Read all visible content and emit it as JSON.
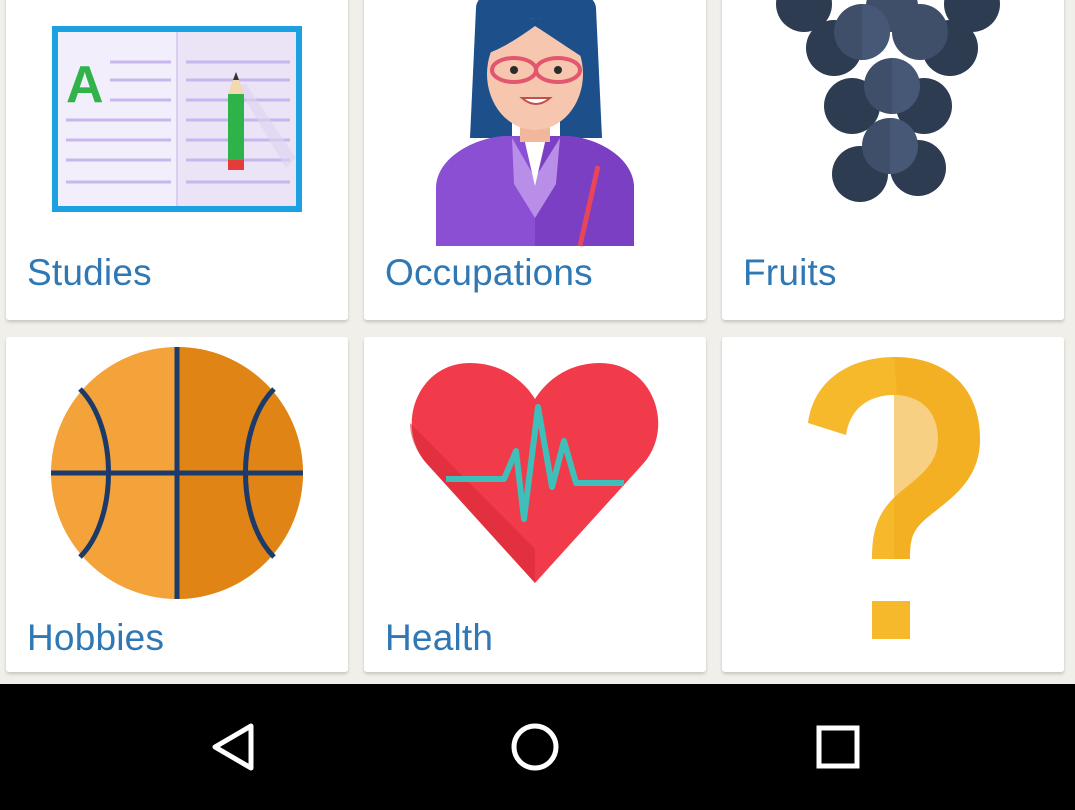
{
  "categories": [
    {
      "label": "Studies",
      "icon": "notebook-icon"
    },
    {
      "label": "Occupations",
      "icon": "teacher-icon"
    },
    {
      "label": "Fruits",
      "icon": "grapes-icon"
    },
    {
      "label": "Hobbies",
      "icon": "basketball-icon"
    },
    {
      "label": "Health",
      "icon": "heartbeat-icon"
    },
    {
      "label": "",
      "icon": "question-mark-icon"
    }
  ],
  "navbar": {
    "back_icon": "back-triangle-icon",
    "home_icon": "home-circle-icon",
    "recents_icon": "recents-square-icon",
    "color": "#000000"
  },
  "colors": {
    "background": "#f1efe9",
    "card": "#ffffff",
    "label": "#2f78b4"
  }
}
